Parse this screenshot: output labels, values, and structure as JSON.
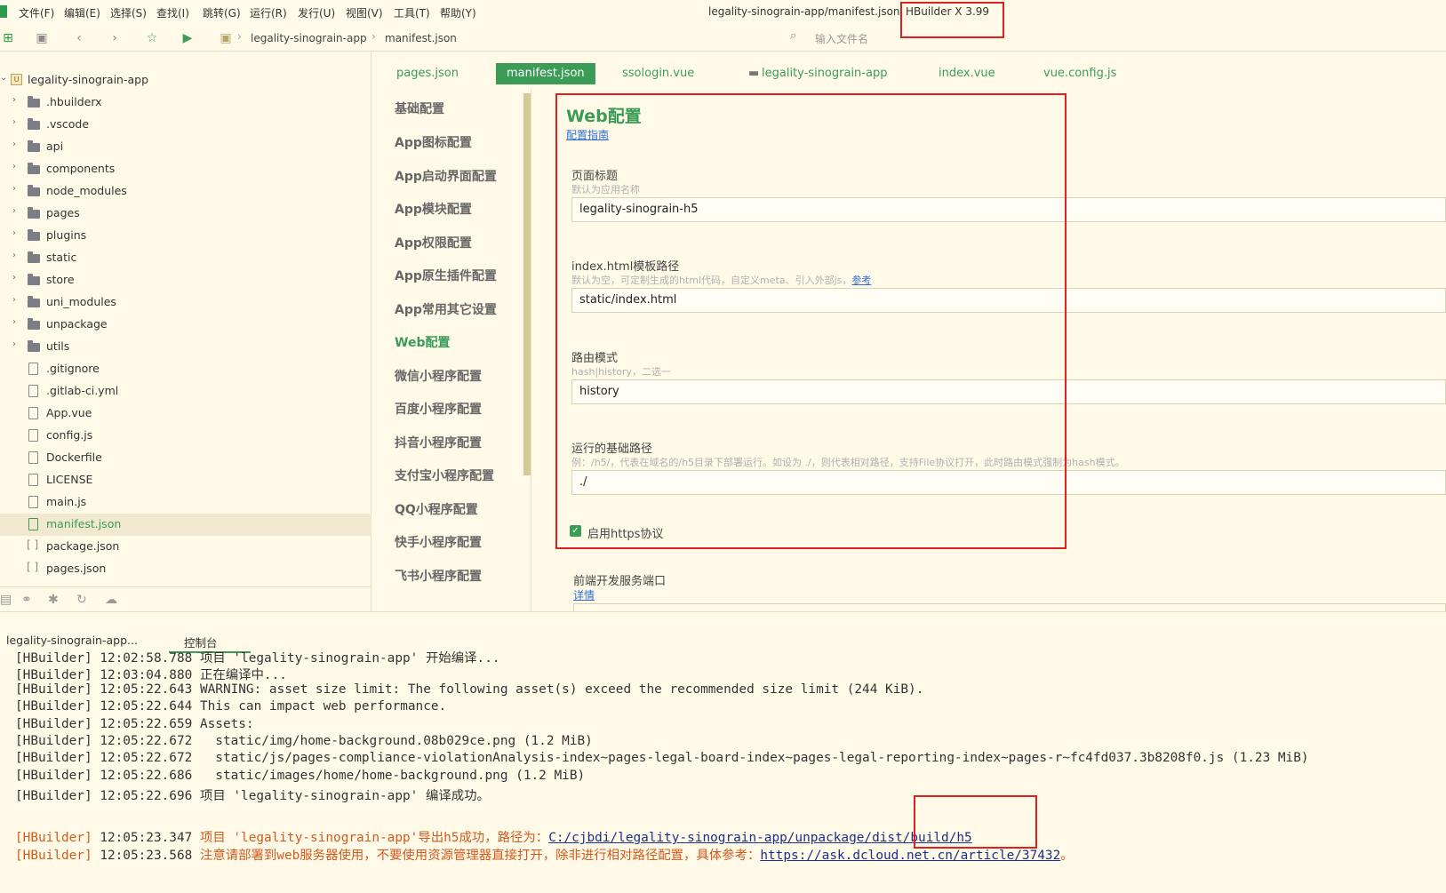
{
  "window": {
    "title": "legality-sinograin-app/manifest.json",
    "product": "HBuilder X 3.99"
  },
  "menu": [
    "文件(F)",
    "编辑(E)",
    "选择(S)",
    "查找(I)",
    "跳转(G)",
    "运行(R)",
    "发行(U)",
    "视图(V)",
    "工具(T)",
    "帮助(Y)"
  ],
  "toolbar": {
    "breadcrumb": [
      "legality-sinograin-app",
      "manifest.json"
    ],
    "file_search_placeholder": "输入文件名"
  },
  "tree": {
    "root": "legality-sinograin-app",
    "items": [
      {
        "label": ".hbuilderx",
        "type": "folder"
      },
      {
        "label": ".vscode",
        "type": "folder"
      },
      {
        "label": "api",
        "type": "folder"
      },
      {
        "label": "components",
        "type": "folder"
      },
      {
        "label": "node_modules",
        "type": "folder"
      },
      {
        "label": "pages",
        "type": "folder"
      },
      {
        "label": "plugins",
        "type": "folder"
      },
      {
        "label": "static",
        "type": "folder"
      },
      {
        "label": "store",
        "type": "folder"
      },
      {
        "label": "uni_modules",
        "type": "folder"
      },
      {
        "label": "unpackage",
        "type": "folder"
      },
      {
        "label": "utils",
        "type": "folder"
      },
      {
        "label": ".gitignore",
        "type": "file"
      },
      {
        "label": ".gitlab-ci.yml",
        "type": "file"
      },
      {
        "label": "App.vue",
        "type": "file"
      },
      {
        "label": "config.js",
        "type": "file"
      },
      {
        "label": "Dockerfile",
        "type": "file"
      },
      {
        "label": "LICENSE",
        "type": "file"
      },
      {
        "label": "main.js",
        "type": "file"
      },
      {
        "label": "manifest.json",
        "type": "file",
        "active": true
      },
      {
        "label": "package.json",
        "type": "json"
      },
      {
        "label": "pages.json",
        "type": "json"
      }
    ]
  },
  "tabs": [
    "pages.json",
    "manifest.json",
    "ssologin.vue",
    "legality-sinograin-app",
    "index.vue",
    "vue.config.js"
  ],
  "active_tab": "manifest.json",
  "nav": [
    "基础配置",
    "App图标配置",
    "App启动界面配置",
    "App模块配置",
    "App权限配置",
    "App原生插件配置",
    "App常用其它设置",
    "Web配置",
    "微信小程序配置",
    "百度小程序配置",
    "抖音小程序配置",
    "支付宝小程序配置",
    "QQ小程序配置",
    "快手小程序配置",
    "飞书小程序配置"
  ],
  "active_nav": "Web配置",
  "form": {
    "title": "Web配置",
    "guide_link": "配置指南",
    "page_title": {
      "label": "页面标题",
      "hint": "默认为应用名称",
      "value": "legality-sinograin-h5"
    },
    "template_path": {
      "label": "index.html模板路径",
      "hint": "默认为空，可定制生成的html代码，自定义meta、引入外部js，",
      "hint_link": "参考",
      "value": "static/index.html"
    },
    "router_mode": {
      "label": "路由模式",
      "hint": "hash|history，二选一",
      "value": "history"
    },
    "base_path": {
      "label": "运行的基础路径",
      "hint": "例：/h5/，代表在域名的/h5目录下部署运行。如设为 ./，则代表相对路径，支持File协议打开，此时路由模式强制为hash模式。",
      "value": "./"
    },
    "https": {
      "label": "启用https协议",
      "checked": true
    },
    "dev_port": {
      "label": "前端开发服务端口",
      "link": "详情"
    }
  },
  "console": {
    "project_tab": "legality-sinograin-app...",
    "console_tab": "控制台",
    "lines": [
      {
        "tag": "[HBuilder]",
        "time": "12:02:58.788",
        "text": "项目 'legality-sinograin-app' 开始编译..."
      },
      {
        "tag": "[HBuilder]",
        "time": "12:03:04.880",
        "text": "正在编译中..."
      },
      {
        "tag": "[HBuilder]",
        "time": "12:05:22.643",
        "text": "WARNING: asset size limit: The following asset(s) exceed the recommended size limit (244 KiB)."
      },
      {
        "tag": "[HBuilder]",
        "time": "12:05:22.644",
        "text": "This can impact web performance."
      },
      {
        "tag": "[HBuilder]",
        "time": "12:05:22.659",
        "text": "Assets:"
      },
      {
        "tag": "[HBuilder]",
        "time": "12:05:22.672",
        "text": "  static/img/home-background.08b029ce.png (1.2 MiB)"
      },
      {
        "tag": "[HBuilder]",
        "time": "12:05:22.672",
        "text": "  static/js/pages-compliance-violationAnalysis-index~pages-legal-board-index~pages-legal-reporting-index~pages-r~fc4fd037.3b8208f0.js (1.23 MiB)"
      },
      {
        "tag": "[HBuilder]",
        "time": "12:05:22.686",
        "text": "  static/images/home/home-background.png (1.2 MiB)"
      },
      {
        "tag": "[HBuilder]",
        "time": "12:05:22.696",
        "text": "项目 'legality-sinograin-app' 编译成功。"
      }
    ],
    "export_line": {
      "tag": "[HBuilder]",
      "time": "12:05:23.347",
      "text": "项目 'legality-sinograin-app'导出h5成功，路径为：",
      "link": "C:/cjbdi/legality-sinograin-app/unpackage/dist/build/h5"
    },
    "notice_line": {
      "tag": "[HBuilder]",
      "time": "12:05:23.568",
      "text": "注意请部署到web服务器使用，不要使用资源管理器直接打开，除非进行相对路径配置，具体参考：",
      "link": "https://ask.dcloud.net.cn/article/37432",
      "suffix": "。"
    }
  },
  "colors": {
    "accent": "#3b9c57",
    "background": "#fffae8",
    "annotation": "#e02020",
    "warning": "#d25a1c"
  }
}
